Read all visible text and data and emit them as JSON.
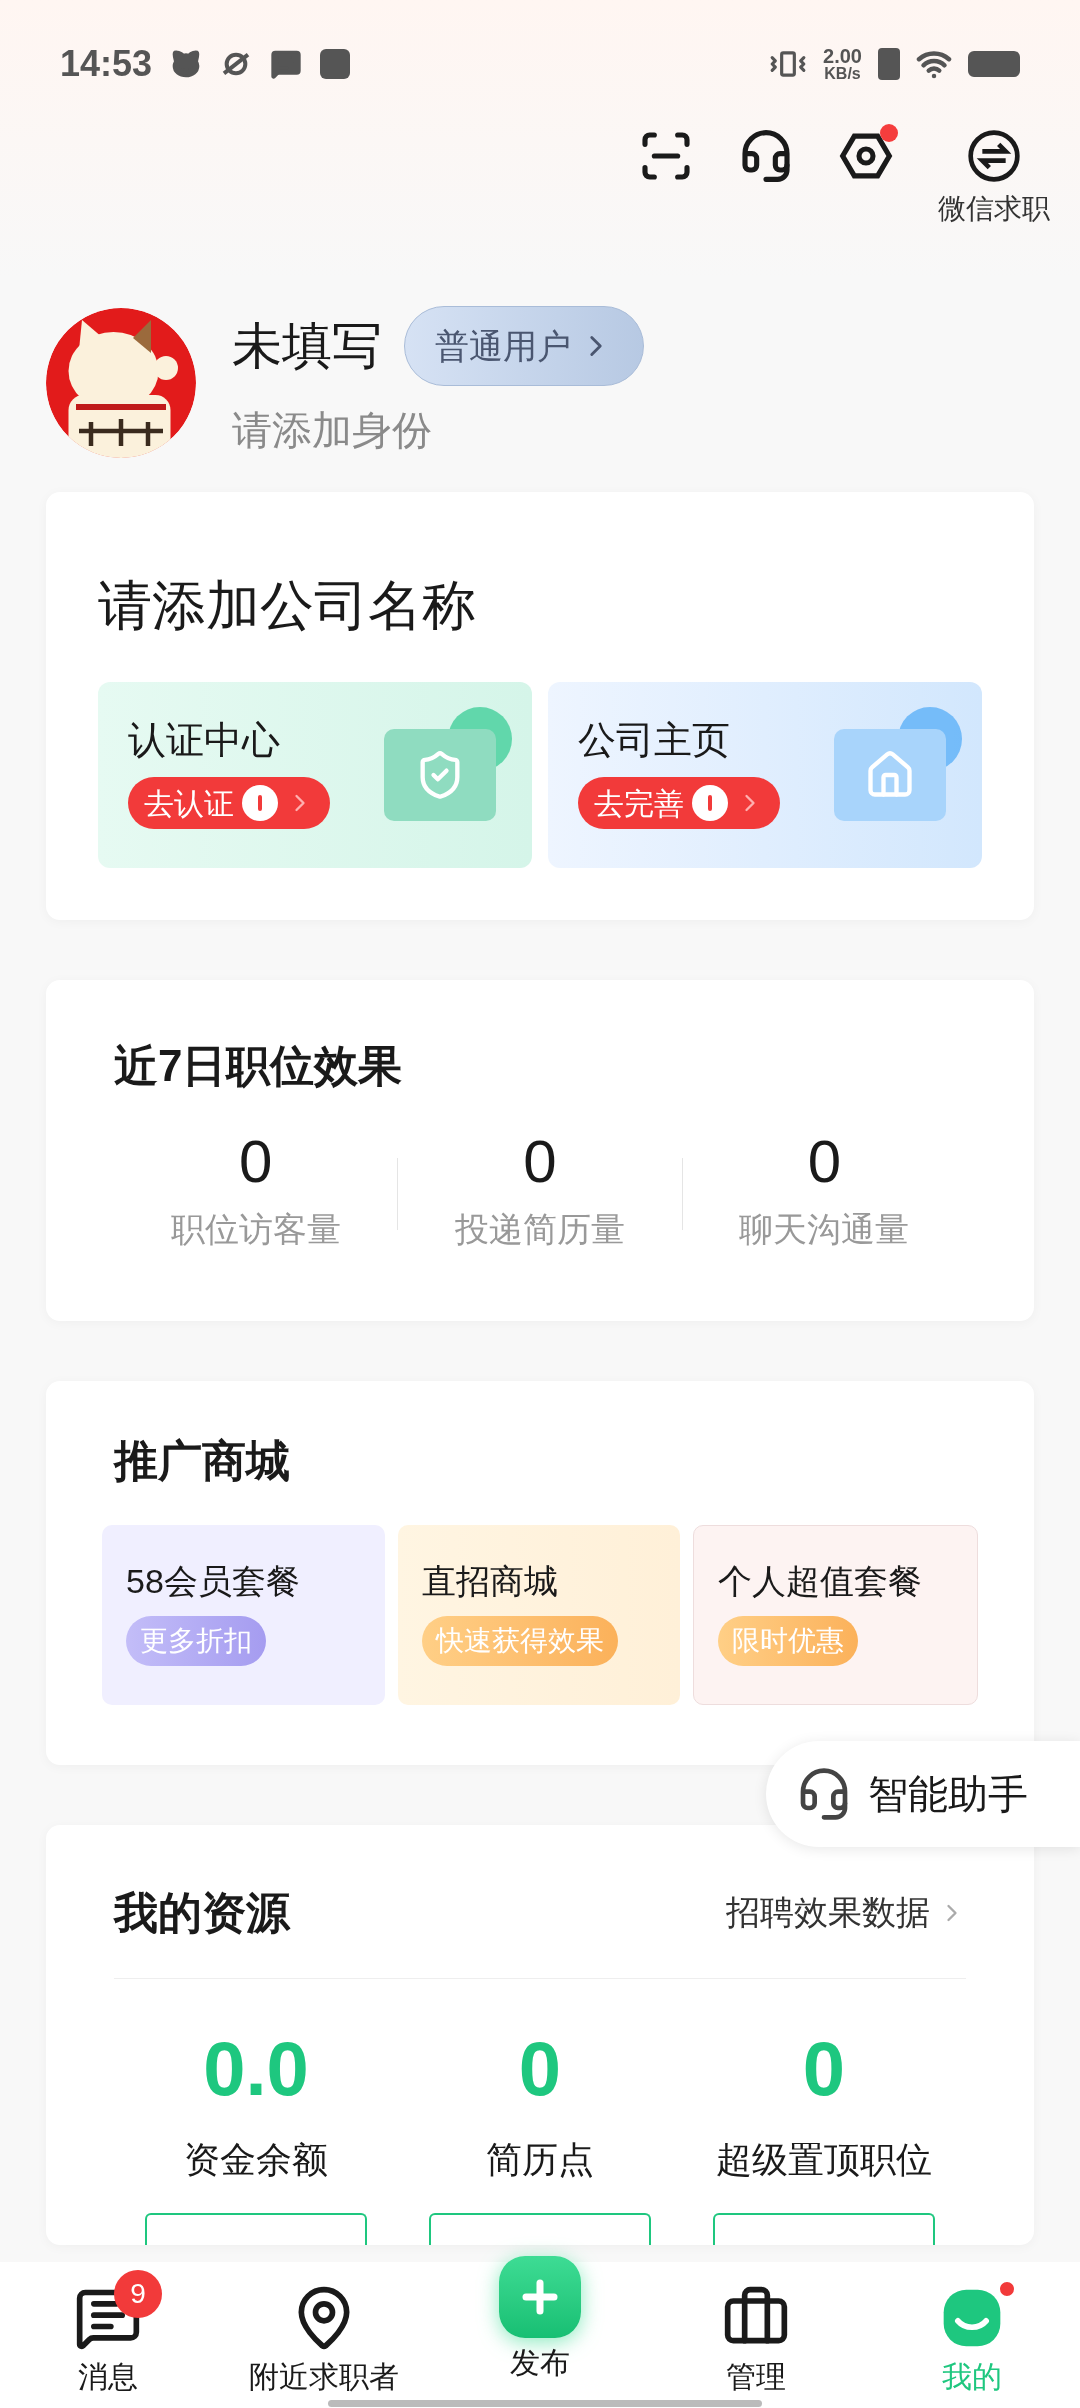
{
  "status_bar": {
    "time": "14:53",
    "speed_value": "2.00",
    "speed_unit": "KB/s"
  },
  "header_actions": [
    {
      "kind": "scan"
    },
    {
      "kind": "service"
    },
    {
      "kind": "settings",
      "dot": true
    },
    {
      "kind": "switch",
      "label": "微信求职"
    }
  ],
  "profile": {
    "name": "未填写",
    "level_badge": "普通用户",
    "subtitle": "请添加身份"
  },
  "company_card": {
    "title": "请添加公司名称",
    "tiles": [
      {
        "kind": "verify",
        "title": "认证中心",
        "action": "去认证"
      },
      {
        "kind": "home",
        "title": "公司主页",
        "action": "去完善"
      }
    ]
  },
  "stats": {
    "title": "近7日职位效果",
    "items": [
      {
        "value": "0",
        "label": "职位访客量"
      },
      {
        "value": "0",
        "label": "投递简历量"
      },
      {
        "value": "0",
        "label": "聊天沟通量"
      }
    ]
  },
  "mall": {
    "title": "推广商城",
    "tiles": [
      {
        "kind": "purple",
        "title": "58会员套餐",
        "tag": "更多折扣"
      },
      {
        "kind": "orange",
        "title": "直招商城",
        "tag": "快速获得效果"
      },
      {
        "kind": "pink",
        "title": "个人超值套餐",
        "tag": "限时优惠"
      }
    ]
  },
  "assistant": {
    "label": "智能助手"
  },
  "resources": {
    "title": "我的资源",
    "link": "招聘效果数据",
    "items": [
      {
        "value": "0.0",
        "label": "资金余额"
      },
      {
        "value": "0",
        "label": "简历点"
      },
      {
        "value": "0",
        "label": "超级置顶职位"
      }
    ]
  },
  "nav": [
    {
      "kind": "messages",
      "label": "消息",
      "selected": false,
      "badge": "9"
    },
    {
      "kind": "nearby",
      "label": "附近求职者",
      "selected": false
    },
    {
      "kind": "publish",
      "label": "发布",
      "selected": false
    },
    {
      "kind": "manage",
      "label": "管理",
      "selected": false
    },
    {
      "kind": "mine",
      "label": "我的",
      "selected": true,
      "dot": true
    }
  ]
}
